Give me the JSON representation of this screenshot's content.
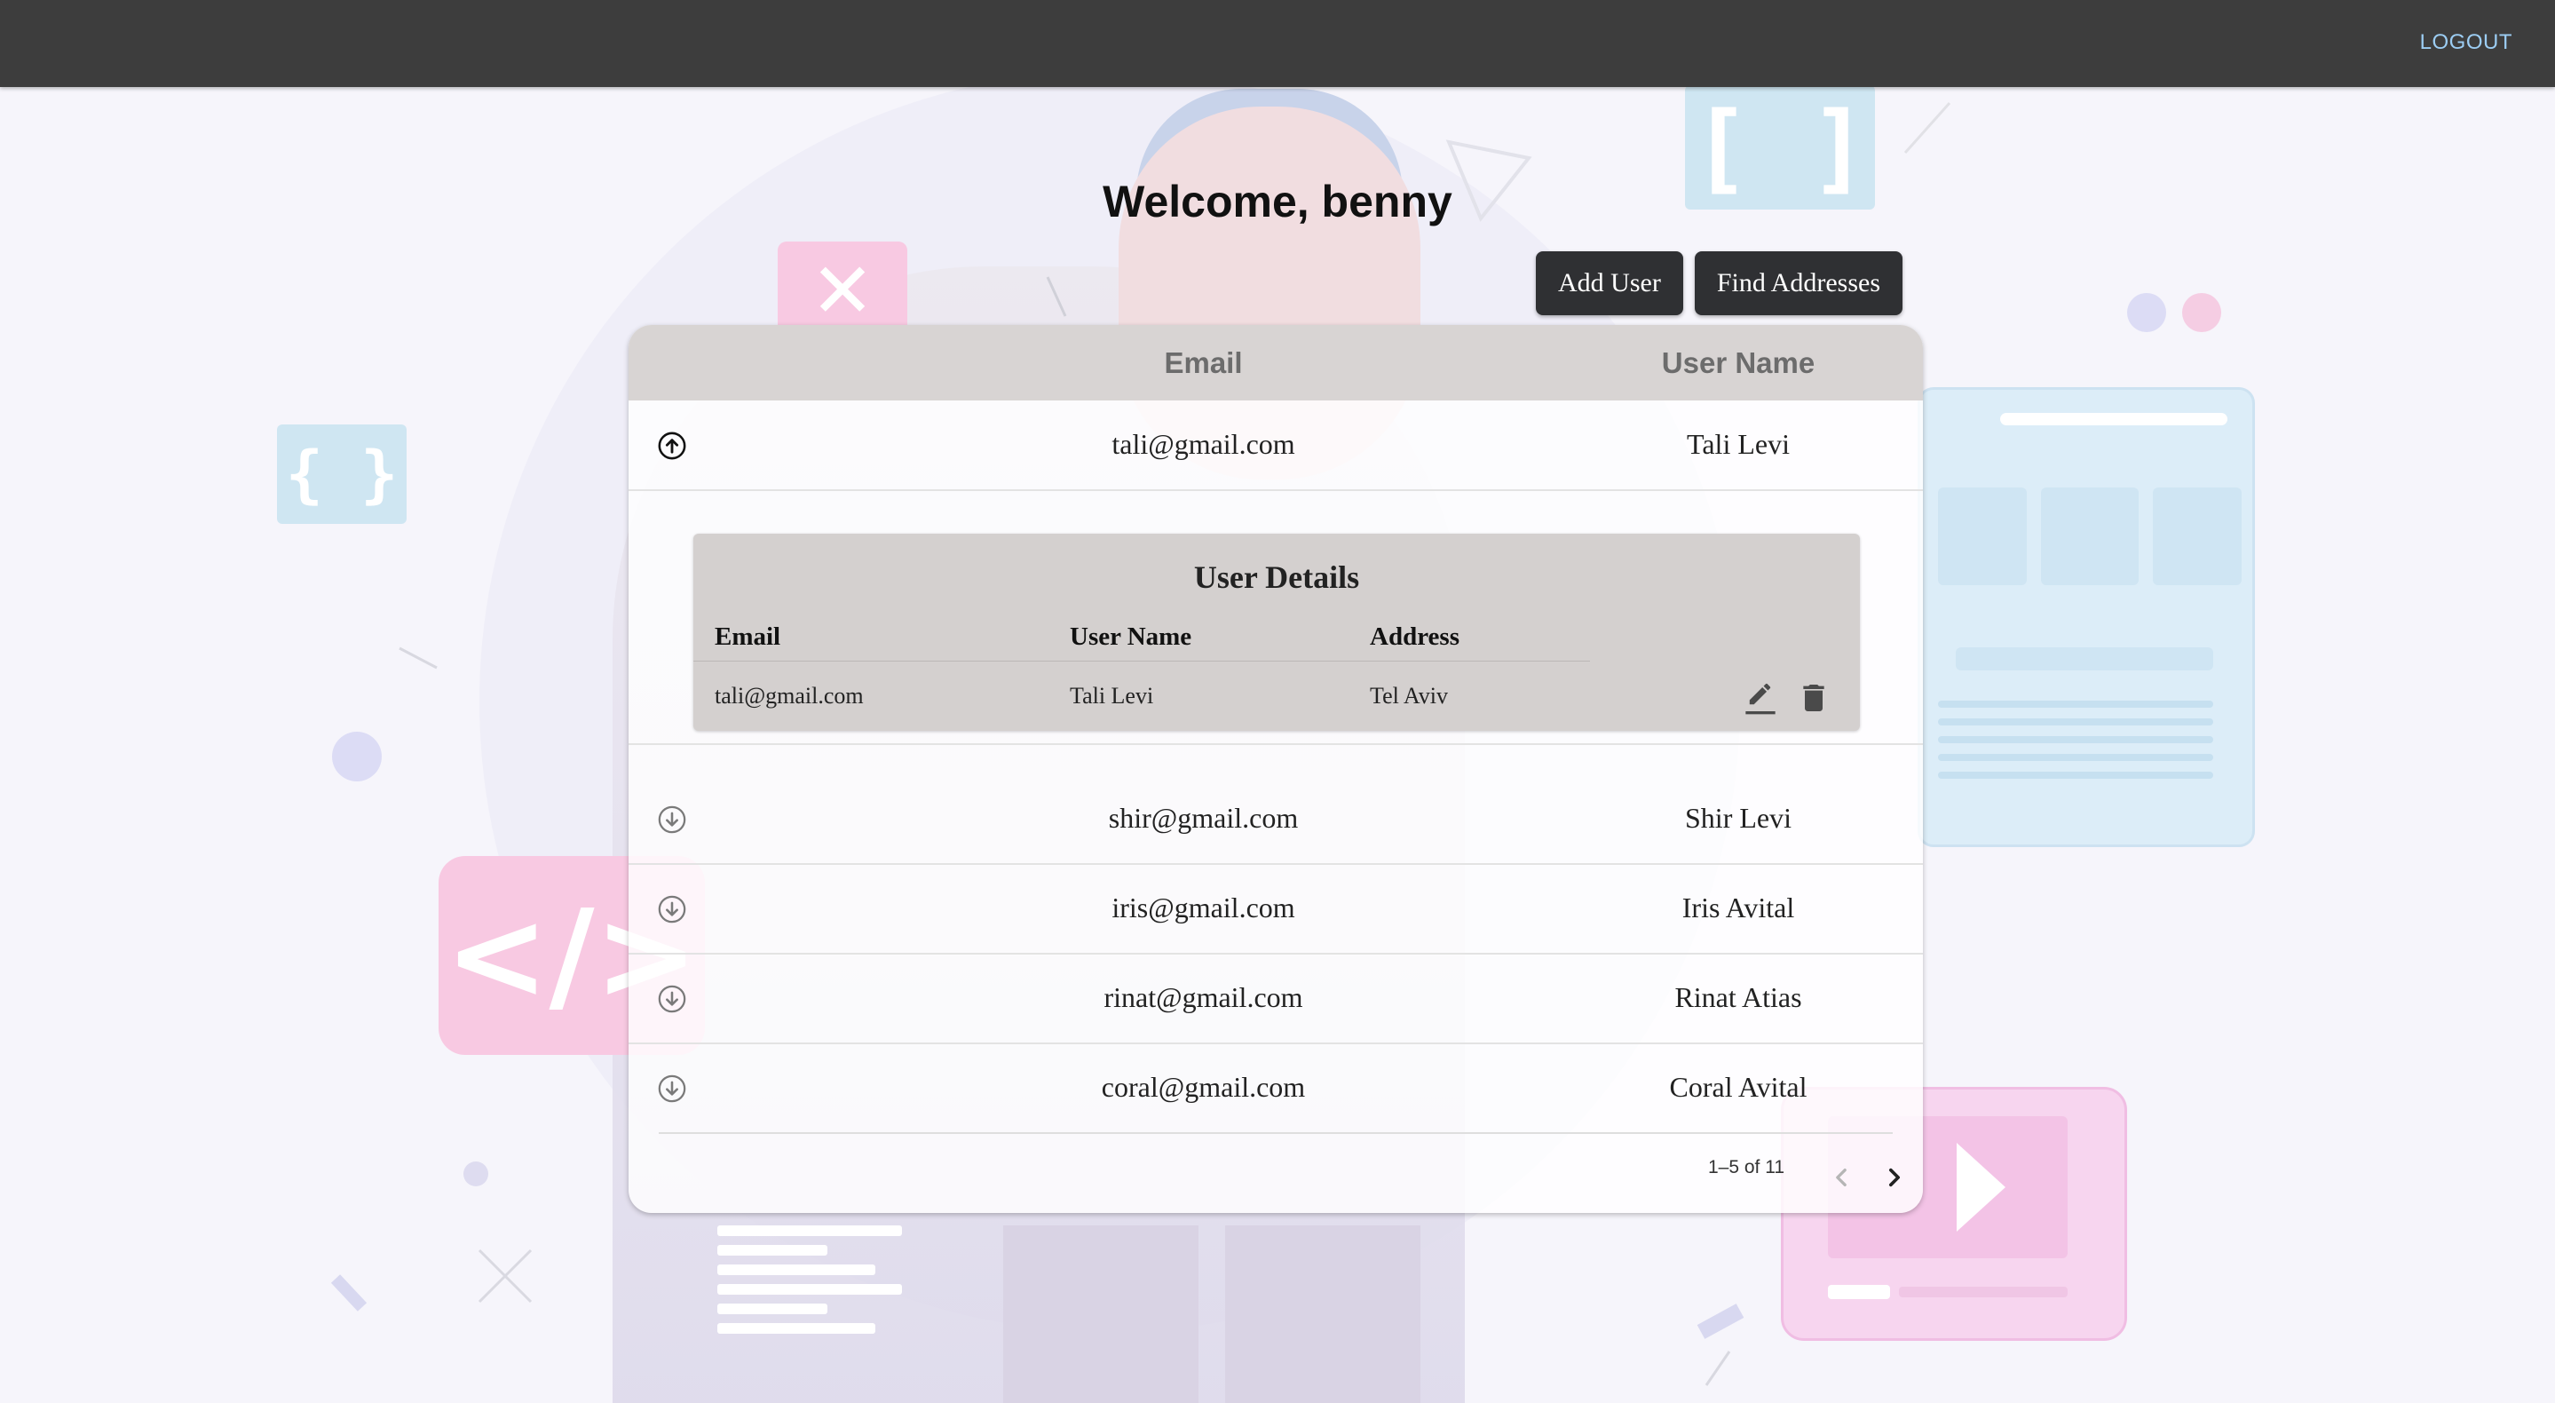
{
  "header": {
    "logout_label": "LOGOUT"
  },
  "welcome": "Welcome, benny",
  "toolbar": {
    "add_user_label": "Add User",
    "find_addresses_label": "Find Addresses"
  },
  "table": {
    "columns": [
      "Email",
      "User Name"
    ],
    "rows": [
      {
        "email": "tali@gmail.com",
        "user_name": "Tali Levi",
        "expanded": true
      },
      {
        "email": "shir@gmail.com",
        "user_name": "Shir Levi",
        "expanded": false
      },
      {
        "email": "iris@gmail.com",
        "user_name": "Iris Avital",
        "expanded": false
      },
      {
        "email": "rinat@gmail.com",
        "user_name": "Rinat Atias",
        "expanded": false
      },
      {
        "email": "coral@gmail.com",
        "user_name": "Coral Avital",
        "expanded": false
      }
    ],
    "pagination": "1–5 of 11"
  },
  "user_details": {
    "title": "User Details",
    "headers": [
      "Email",
      "User Name",
      "Address"
    ],
    "values": {
      "email": "tali@gmail.com",
      "user_name": "Tali Levi",
      "address": "Tel Aviv"
    }
  },
  "icons": {
    "collapse": "arrow-circle-up-icon",
    "expand": "arrow-circle-down-icon",
    "edit": "pencil-icon",
    "delete": "trash-icon",
    "prev": "chevron-left-icon",
    "next": "chevron-right-icon"
  },
  "colors": {
    "topbar": "#3d3d3d",
    "logout": "#9ccdf3",
    "button": "#2f3033",
    "table_header": "#d8d4d3",
    "details_panel": "#d4d0cf"
  }
}
